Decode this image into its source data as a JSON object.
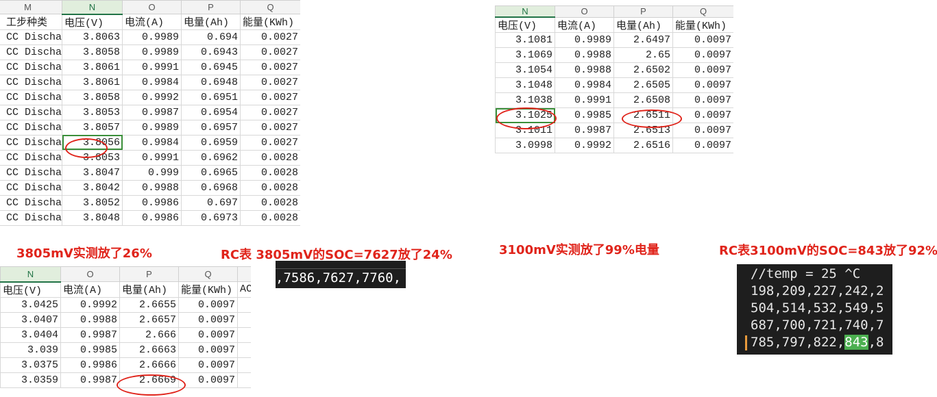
{
  "sheet1": {
    "col_letters": [
      "M",
      "N",
      "O",
      "P",
      "Q"
    ],
    "headers": [
      "工步种类",
      "电压(V)",
      "电流(A)",
      "电量(Ah)",
      "能量(KWh)"
    ],
    "rows": [
      [
        "CC Dischar",
        "3.8063",
        "0.9989",
        "0.694",
        "0.0027"
      ],
      [
        "CC Dischar",
        "3.8058",
        "0.9989",
        "0.6943",
        "0.0027"
      ],
      [
        "CC Dischar",
        "3.8061",
        "0.9991",
        "0.6945",
        "0.0027"
      ],
      [
        "CC Dischar",
        "3.8061",
        "0.9984",
        "0.6948",
        "0.0027"
      ],
      [
        "CC Dischar",
        "3.8058",
        "0.9992",
        "0.6951",
        "0.0027"
      ],
      [
        "CC Dischar",
        "3.8053",
        "0.9987",
        "0.6954",
        "0.0027"
      ],
      [
        "CC Dischar",
        "3.8057",
        "0.9989",
        "0.6957",
        "0.0027"
      ],
      [
        "CC Dischar",
        "3.8056",
        "0.9984",
        "0.6959",
        "0.0027"
      ],
      [
        "CC Dischar",
        "3.8053",
        "0.9991",
        "0.6962",
        "0.0028"
      ],
      [
        "CC Dischar",
        "3.8047",
        "0.999",
        "0.6965",
        "0.0028"
      ],
      [
        "CC Dischar",
        "3.8042",
        "0.9988",
        "0.6968",
        "0.0028"
      ],
      [
        "CC Dischar",
        "3.8052",
        "0.9986",
        "0.697",
        "0.0028"
      ],
      [
        "CC Dischar",
        "3.8048",
        "0.9986",
        "0.6973",
        "0.0028"
      ]
    ]
  },
  "sheet2": {
    "col_letters": [
      "N",
      "O",
      "P",
      "Q"
    ],
    "headers": [
      "电压(V)",
      "电流(A)",
      "电量(Ah)",
      "能量(KWh)"
    ],
    "rows": [
      [
        "3.1081",
        "0.9989",
        "2.6497",
        "0.0097"
      ],
      [
        "3.1069",
        "0.9988",
        "2.65",
        "0.0097"
      ],
      [
        "3.1054",
        "0.9988",
        "2.6502",
        "0.0097"
      ],
      [
        "3.1048",
        "0.9984",
        "2.6505",
        "0.0097"
      ],
      [
        "3.1038",
        "0.9991",
        "2.6508",
        "0.0097"
      ],
      [
        "3.1025",
        "0.9985",
        "2.6511",
        "0.0097"
      ],
      [
        "3.1011",
        "0.9987",
        "2.6513",
        "0.0097"
      ],
      [
        "3.0998",
        "0.9992",
        "2.6516",
        "0.0097"
      ]
    ]
  },
  "sheet3": {
    "col_letters": [
      "N",
      "O",
      "P",
      "Q"
    ],
    "headers": [
      "电压(V)",
      "电流(A)",
      "电量(Ah)",
      "能量(KWh)",
      "AC"
    ],
    "rows": [
      [
        "3.0425",
        "0.9992",
        "2.6655",
        "0.0097"
      ],
      [
        "3.0407",
        "0.9988",
        "2.6657",
        "0.0097"
      ],
      [
        "3.0404",
        "0.9987",
        "2.666",
        "0.0097"
      ],
      [
        "3.039",
        "0.9985",
        "2.6663",
        "0.0097"
      ],
      [
        "3.0375",
        "0.9986",
        "2.6666",
        "0.0097"
      ],
      [
        "3.0359",
        "0.9987",
        "2.6669",
        "0.0097"
      ]
    ]
  },
  "notes": {
    "n1": "3805mV实测放了26%",
    "n2": "RC表 3805mV的SOC=7627放了24%",
    "n3": "3100mV实测放了99%电量",
    "n4": "RC表3100mV的SOC=843放了92%"
  },
  "code1": {
    "line": ",7586,7627,7760,"
  },
  "code2": {
    "lines": [
      "//temp = 25 ^C",
      "198,209,227,242,2",
      "504,514,532,549,5",
      "687,700,721,740,7"
    ],
    "hl_prefix": "785,797,822,",
    "hl_value": "843",
    "hl_suffix": ",8"
  },
  "colors": {
    "annotation": "#e0241b",
    "selection": "#3b8f3a",
    "code_bg": "#1e1e1e",
    "code_highlight": "#4caf50"
  }
}
